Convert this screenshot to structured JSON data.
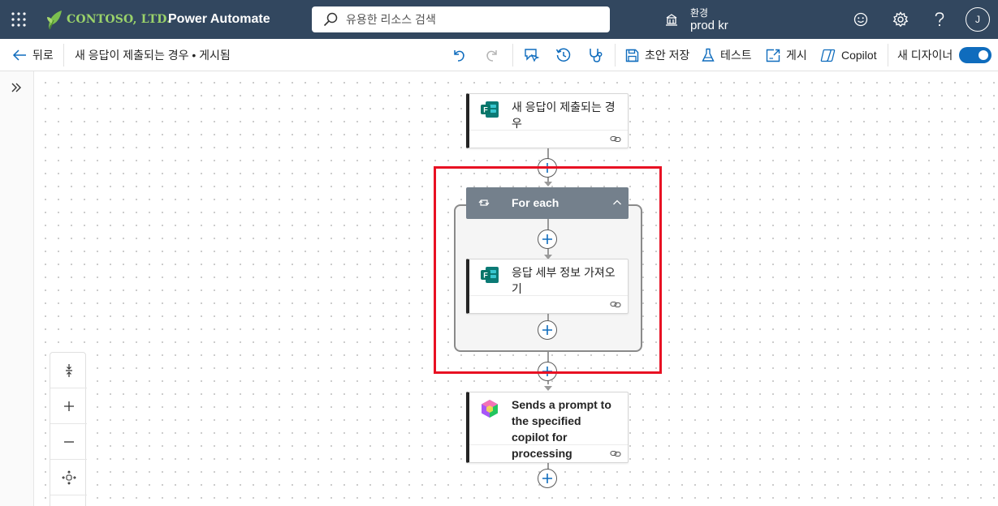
{
  "header": {
    "brand": "CONTOSO, LTD.",
    "app_name": "Power Automate",
    "search_placeholder": "유용한 리소스 검색",
    "env_label": "환경",
    "env_name": "prod kr",
    "avatar_initial": "J",
    "background_color": "#32475f"
  },
  "toolbar": {
    "back_label": "뒤로",
    "flow_title": "새 응답이 제출되는 경우 • 게시됨",
    "save_label": "초안 저장",
    "test_label": "테스트",
    "publish_label": "게시",
    "copilot_label": "Copilot",
    "new_designer_label": "새 디자이너",
    "new_designer_enabled": true
  },
  "flow": {
    "trigger": {
      "title": "새 응답이 제출되는 경우",
      "icon": "forms-icon"
    },
    "foreach": {
      "title": "For each",
      "icon": "loop-icon"
    },
    "inner_action": {
      "title": "응답 세부 정보 가져오기",
      "icon": "forms-icon"
    },
    "copilot_action": {
      "title": "Sends a prompt to the specified copilot for processing",
      "icon": "copilot-studio-icon"
    }
  },
  "colors": {
    "accent": "#0f6cbd",
    "highlight": "#e81123",
    "foreach_header": "#74808c"
  }
}
